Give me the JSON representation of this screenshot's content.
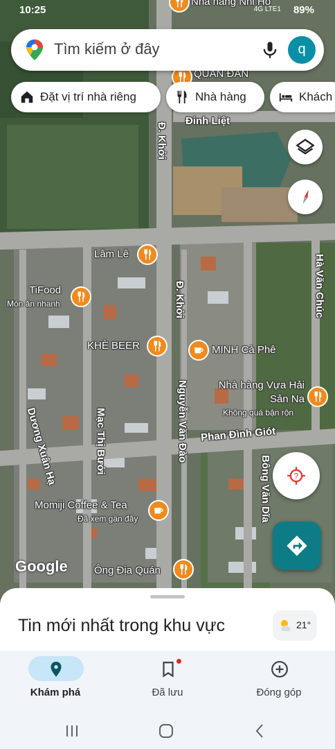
{
  "status": {
    "time": "10:25",
    "battery": "89%",
    "signal": "4G LTE1"
  },
  "search": {
    "placeholder": "Tìm kiếm ở đây",
    "avatar_letter": "q"
  },
  "chips": [
    {
      "label": "Đặt vị trí nhà riêng",
      "icon": "home-icon"
    },
    {
      "label": "Nhà hàng",
      "icon": "restaurant-icon"
    },
    {
      "label": "Khách",
      "icon": "hotel-icon"
    }
  ],
  "map": {
    "places": [
      {
        "name": "Nhà hàng Nhi Ho",
        "sub": ""
      },
      {
        "name": "QUÁN ĐẢN",
        "sub": ""
      },
      {
        "name": "Lâm Lê",
        "sub": ""
      },
      {
        "name": "TiFood",
        "sub": "Món ăn nhanh"
      },
      {
        "name": "KHÈ BEER",
        "sub": ""
      },
      {
        "name": "MINH Cà Phê",
        "sub": ""
      },
      {
        "name": "Nhà hàng Vựa Hải Sản Na",
        "sub": "Không quá bận rộn"
      },
      {
        "name": "Momiji Coffee & Tea",
        "sub": "Đã xem gần đây"
      },
      {
        "name": "Ông Địa Quán",
        "sub": ""
      }
    ],
    "roads": {
      "dinh_liet": "Đinh Liệt",
      "d_khoi": "Đ. Khởi",
      "ha_van_chuc": "Hà Văn Chúc",
      "nguyen_van_dao": "Nguyễn Văn Đào",
      "phan_dinh_giot": "Phan Đình Giót",
      "duong_xuan_ha": "Dương Xuân Hạ",
      "mac_thi_buoi": "Mạc Thị Bưởi",
      "bong_van_dia": "Bông Văn Dĩa"
    },
    "attribution": "Google"
  },
  "sheet": {
    "title": "Tin mới nhất trong khu vực",
    "temperature": "21°"
  },
  "nav": {
    "tabs": [
      {
        "label": "Khám phá",
        "icon": "explore-pin-icon",
        "active": true
      },
      {
        "label": "Đã lưu",
        "icon": "bookmark-icon",
        "active": false
      },
      {
        "label": "Đóng góp",
        "icon": "add-circle-icon",
        "active": false
      }
    ]
  },
  "colors": {
    "accent": "#0e7c86",
    "poi": "#f08a1c",
    "active_tab": "#c7e6f8"
  }
}
